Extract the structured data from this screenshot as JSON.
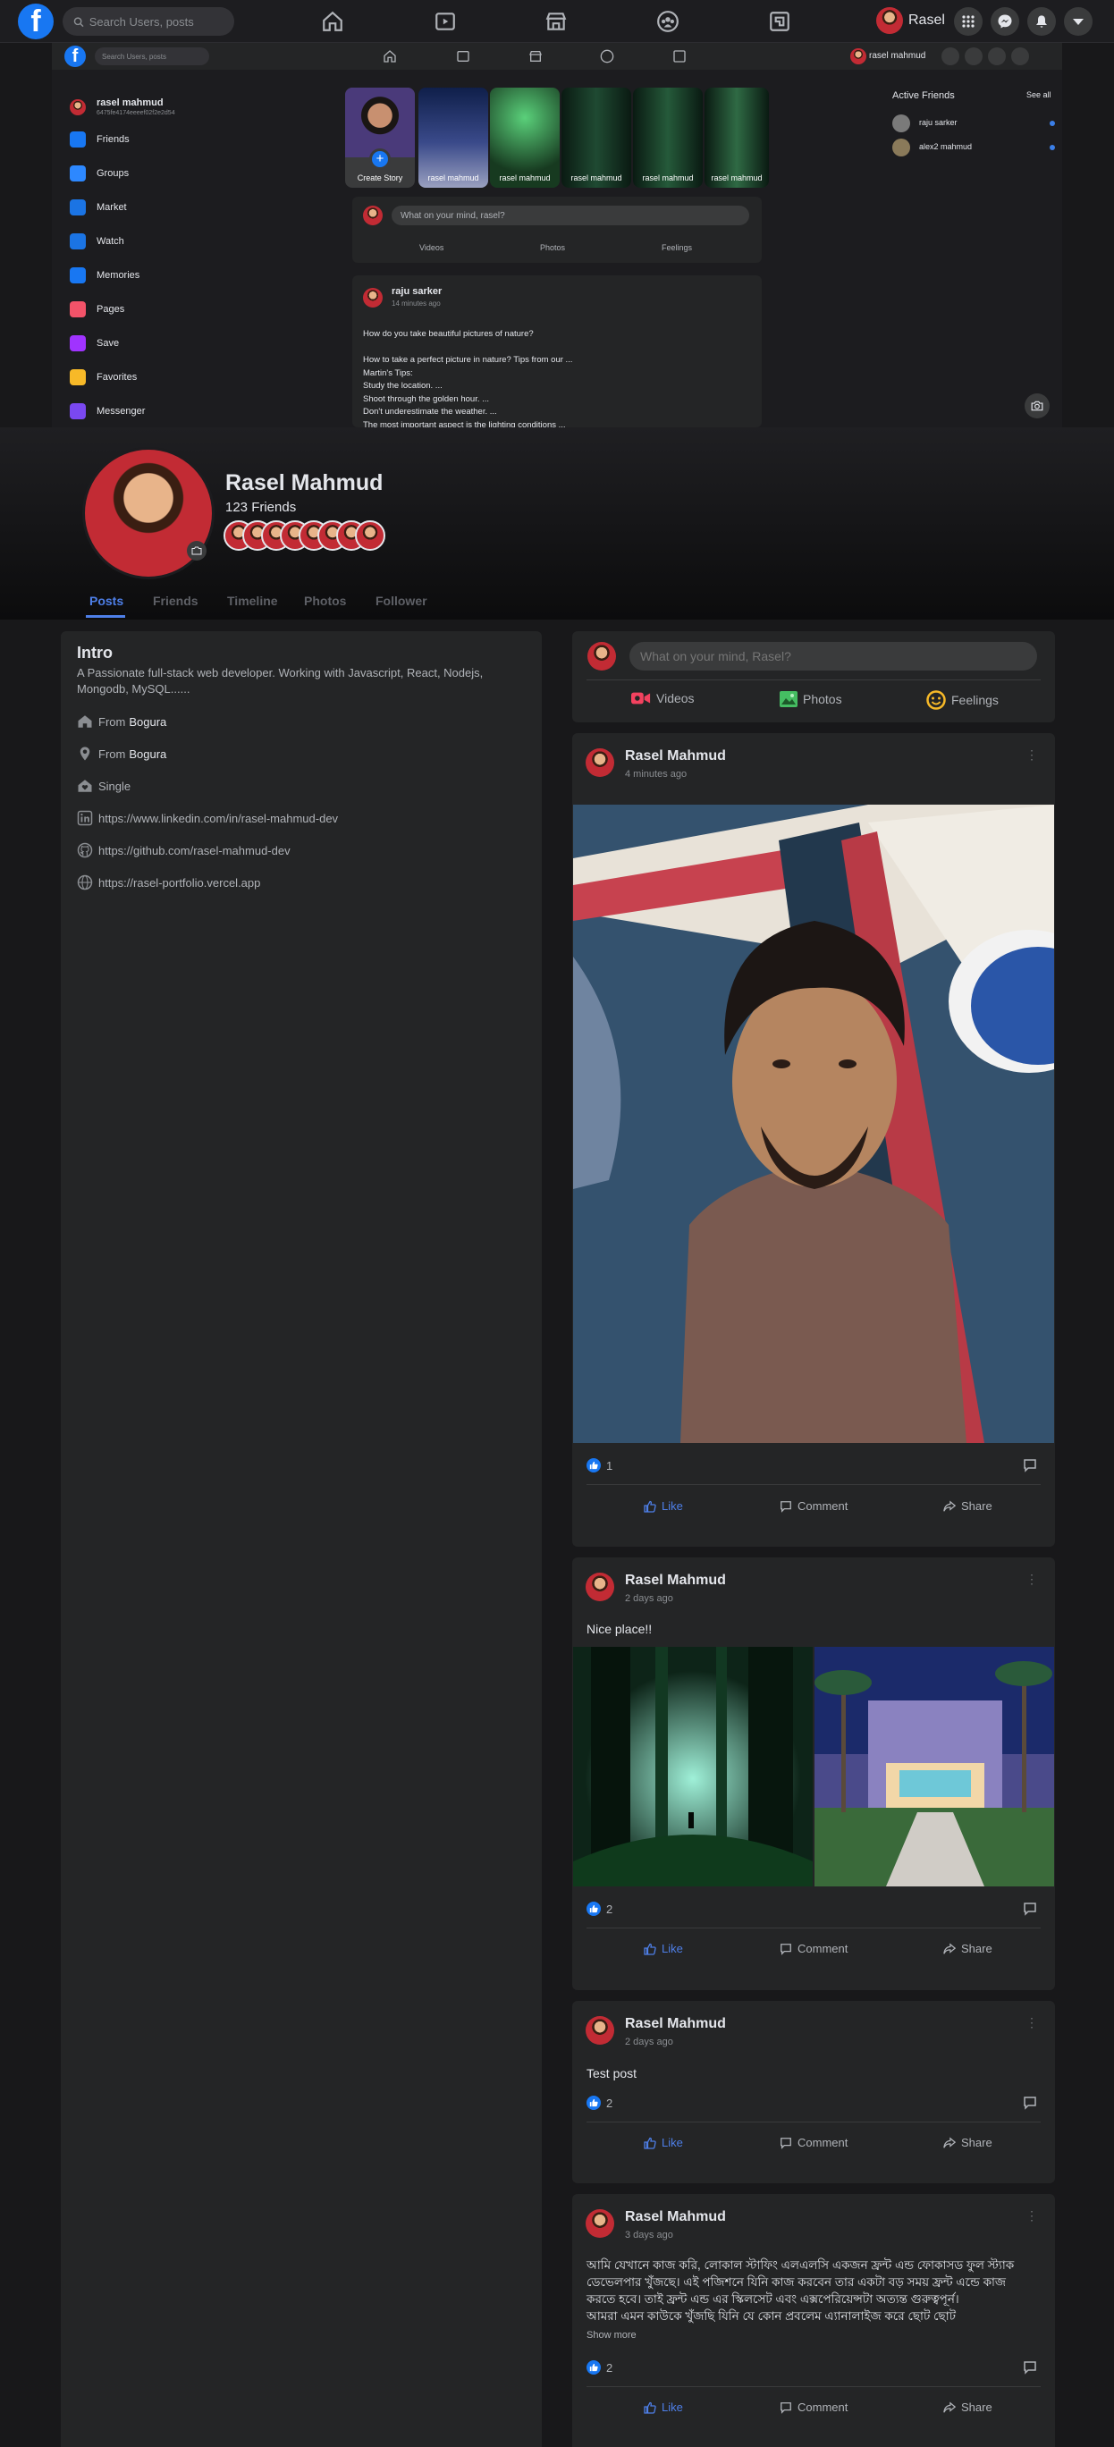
{
  "topnav": {
    "search_placeholder": "Search Users, posts",
    "user_name": "Rasel"
  },
  "cover": {
    "search_placeholder": "Search Users, posts",
    "user_name": "rasel mahmud",
    "sidebar": {
      "profile_name": "rasel mahmud",
      "profile_id": "6475fe4174eeeef02f2e2d54",
      "items": [
        {
          "label": "Friends",
          "color": "#1877f2"
        },
        {
          "label": "Groups",
          "color": "#2d88ff"
        },
        {
          "label": "Market",
          "color": "#1b74e4"
        },
        {
          "label": "Watch",
          "color": "#1b74e4"
        },
        {
          "label": "Memories",
          "color": "#1877f2"
        },
        {
          "label": "Pages",
          "color": "#f35369"
        },
        {
          "label": "Save",
          "color": "#a033ff"
        },
        {
          "label": "Favorites",
          "color": "#f7b928"
        },
        {
          "label": "Messenger",
          "color": "#7a48f0"
        }
      ]
    },
    "stories": [
      {
        "label": "Create Story"
      },
      {
        "label": "rasel mahmud"
      },
      {
        "label": "rasel mahmud"
      },
      {
        "label": "rasel mahmud"
      },
      {
        "label": "rasel mahmud"
      },
      {
        "label": "rasel mahmud"
      }
    ],
    "composer_placeholder": "What on your mind, rasel?",
    "composer_actions": [
      "Videos",
      "Photos",
      "Feelings"
    ],
    "feed_post": {
      "author": "raju sarker",
      "time": "14 minutes ago",
      "lines": [
        "How do you take beautiful pictures of nature?",
        "",
        "How to take a perfect picture in nature? Tips from our ...",
        "Martin's Tips:",
        "Study the location. ...",
        "Shoot through the golden hour. ...",
        "Don't underestimate the weather. ...",
        "The most important aspect is the lighting conditions ..."
      ]
    },
    "active_friends": {
      "title": "Active Friends",
      "see_all": "See all",
      "friends": [
        "raju sarker",
        "alex2 mahmud"
      ]
    }
  },
  "profile": {
    "name": "Rasel Mahmud",
    "friends_count": "123 Friends",
    "friend_avatar_count": 8
  },
  "tabs": [
    "Posts",
    "Friends",
    "Timeline",
    "Photos",
    "Follower"
  ],
  "intro": {
    "title": "Intro",
    "bio": "A Passionate full-stack web developer. Working with Javascript, React, Nodejs, Mongodb, MySQL......",
    "from_label": "From",
    "hometown": "Bogura",
    "location": "Bogura",
    "relationship": "Single",
    "linkedin": "https://www.linkedin.com/in/rasel-mahmud-dev",
    "github": "https://github.com/rasel-mahmud-dev",
    "website": "https://rasel-portfolio.vercel.app"
  },
  "composer": {
    "placeholder": "What on your mind, Rasel?",
    "videos": "Videos",
    "photos": "Photos",
    "feelings": "Feelings"
  },
  "post_actions": {
    "like": "Like",
    "comment": "Comment",
    "share": "Share"
  },
  "posts": [
    {
      "author": "Rasel Mahmud",
      "time": "4 minutes ago",
      "text": "",
      "likes": "1"
    },
    {
      "author": "Rasel Mahmud",
      "time": "2 days ago",
      "text": "Nice place!!",
      "likes": "2"
    },
    {
      "author": "Rasel Mahmud",
      "time": "2 days ago",
      "text": "Test post",
      "likes": "2"
    },
    {
      "author": "Rasel Mahmud",
      "time": "3 days ago",
      "lines": [
        "আমি যেখানে কাজ করি, লোকাল স্টাফিং এলএলসি একজন ফ্রন্ট এন্ড ফোকাসড ফুল স্ট্যাক",
        "ডেভেলপার খুঁজছে। এই পজিশনে যিনি কাজ করবেন তার একটা বড় সময় ফ্রন্ট এন্ডে কাজ",
        "করতে হবে। তাই ফ্রন্ট এন্ড এর স্কিলসেট এবং এক্সপেরিয়েন্সটা অত্যন্ত গুরুত্বপূর্ন।",
        "আমরা এমন কাউকে খুঁজছি যিনি যে কোন প্রবলেম এ্যানালাইজ করে ছোট ছোট"
      ],
      "show_more": "Show more",
      "likes": "2"
    }
  ]
}
